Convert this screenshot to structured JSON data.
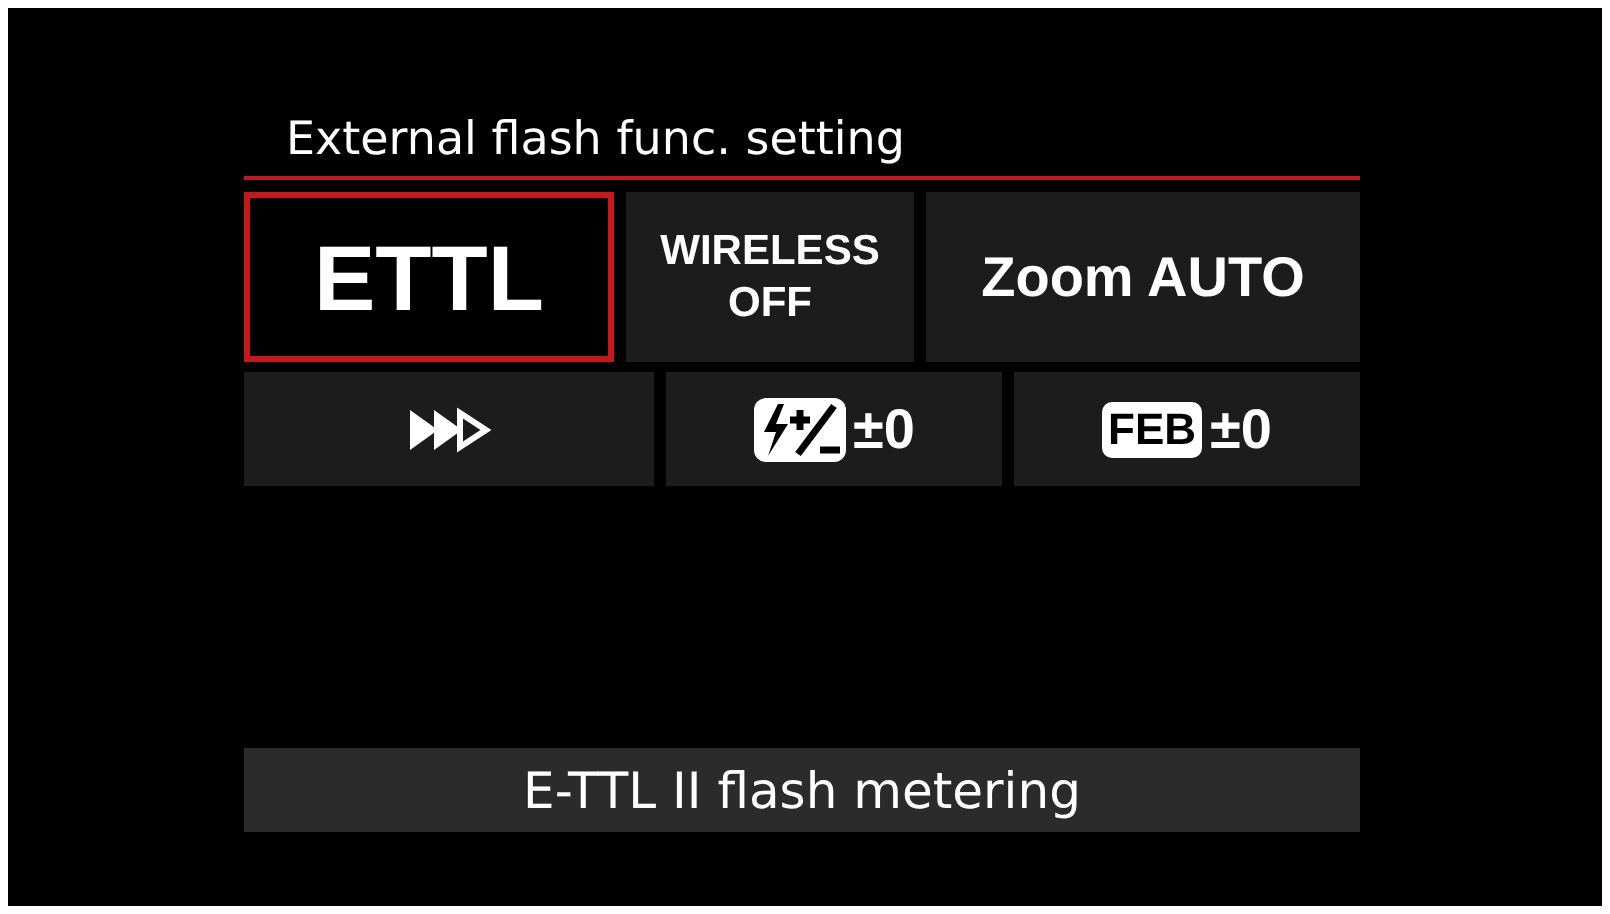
{
  "title": "External flash func. setting",
  "top_row": [
    {
      "kind": "big",
      "label": "ETTL",
      "selected": true
    },
    {
      "kind": "two_line",
      "lines": [
        "WIRELESS",
        "OFF"
      ],
      "selected": false
    },
    {
      "kind": "big_text",
      "label": "Zoom AUTO",
      "selected": false
    }
  ],
  "bottom_row": [
    {
      "kind": "sync",
      "selected": false
    },
    {
      "kind": "comp",
      "value": "±0",
      "selected": false
    },
    {
      "kind": "feb",
      "badge": "FEB",
      "value": "±0",
      "selected": false
    }
  ],
  "status_bar": "E-TTL II flash metering"
}
